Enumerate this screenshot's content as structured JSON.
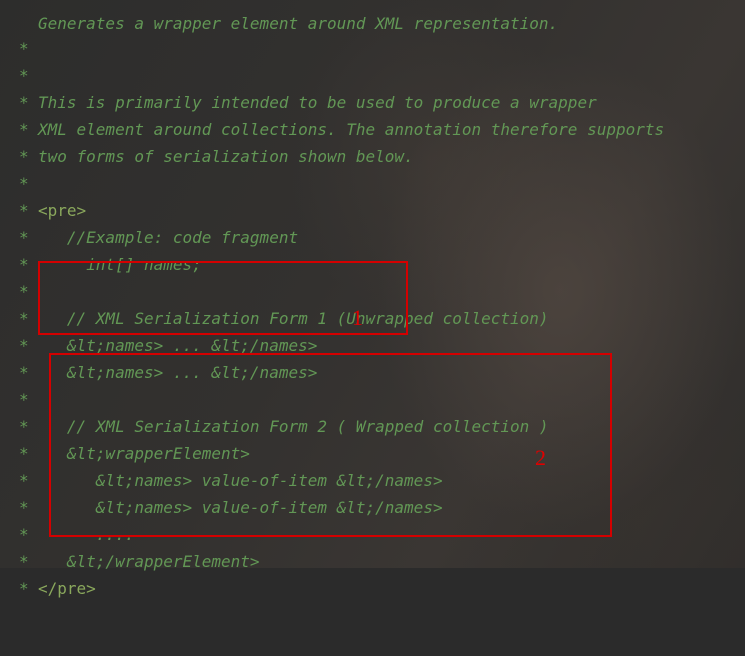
{
  "editor": {
    "partial_line": "Generates a wrapper element around XML representation.",
    "lines": [
      {
        "star": "*",
        "text": ""
      },
      {
        "star": "*",
        "text": "This is primarily intended to be used to produce a wrapper"
      },
      {
        "star": "*",
        "text": "XML element around collections. The annotation therefore supports"
      },
      {
        "star": "*",
        "text": "two forms of serialization shown below."
      },
      {
        "star": "*",
        "text": ""
      },
      {
        "star": "*",
        "text": "<pre>"
      },
      {
        "star": "*",
        "text": "   //Example: code fragment"
      },
      {
        "star": "*",
        "text": "     int[] names;"
      },
      {
        "star": "*",
        "text": ""
      },
      {
        "star": "*",
        "text": "   // XML Serialization Form 1 (Unwrapped collection)"
      },
      {
        "star": "*",
        "text": "   &lt;names> ... &lt;/names>"
      },
      {
        "star": "*",
        "text": "   &lt;names> ... &lt;/names>"
      },
      {
        "star": "*",
        "text": ""
      },
      {
        "star": "*",
        "text": "   // XML Serialization Form 2 ( Wrapped collection )"
      },
      {
        "star": "*",
        "text": "   &lt;wrapperElement>"
      },
      {
        "star": "*",
        "text": "      &lt;names> value-of-item &lt;/names>"
      },
      {
        "star": "*",
        "text": "      &lt;names> value-of-item &lt;/names>"
      },
      {
        "star": "*",
        "text": "      ...."
      },
      {
        "star": "*",
        "text": "   &lt;/wrapperElement>"
      },
      {
        "star": "*",
        "text": "</pre>"
      },
      {
        "star": "*",
        "text": ""
      }
    ]
  },
  "annotations": {
    "box1_label": "1",
    "box2_label": "2",
    "color": "#d40000"
  }
}
